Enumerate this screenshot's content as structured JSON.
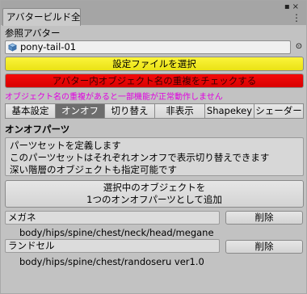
{
  "window": {
    "tab_title": "アバタービルド全",
    "lock_icon": "lock-icon",
    "close_icon": "close-icon",
    "menu_icon": "kebab-menu-icon"
  },
  "reference": {
    "label": "参照アバター",
    "value": "pony-tail-01",
    "object_icon": "cube-icon",
    "picker_icon": "object-picker-icon"
  },
  "buttons": {
    "select_config": "設定ファイルを選択",
    "check_duplicates": "アバター内オブジェクト名の重複をチェックする"
  },
  "warning": "オブジェクト名の重複があると一部機能が正常動作しません",
  "tabs": [
    {
      "label": "基本設定",
      "active": false
    },
    {
      "label": "オンオフ",
      "active": true
    },
    {
      "label": "切り替え",
      "active": false
    },
    {
      "label": "非表示",
      "active": false
    },
    {
      "label": "Shapekey",
      "active": false
    },
    {
      "label": "シェーダー",
      "active": false
    }
  ],
  "section": {
    "title": "オンオフパーツ",
    "help_lines": [
      "パーツセットを定義します",
      "このパーツセットはそれぞれオンオフで表示切り替えできます",
      "深い階層のオブジェクトも指定可能です"
    ],
    "add_button_line1": "選択中のオブジェクトを",
    "add_button_line2": "1つのオンオフパーツとして追加"
  },
  "parts": [
    {
      "name": "メガネ",
      "delete_label": "削除",
      "path": "body/hips/spine/chest/neck/head/megane"
    },
    {
      "name": "ランドセル",
      "delete_label": "削除",
      "path": "body/hips/spine/chest/randoseru ver1.0"
    }
  ],
  "colors": {
    "yellow_button": "#f3ec22",
    "red_button": "#e90505",
    "warning_text": "#e000e0",
    "active_tab": "#6d6d6d"
  }
}
